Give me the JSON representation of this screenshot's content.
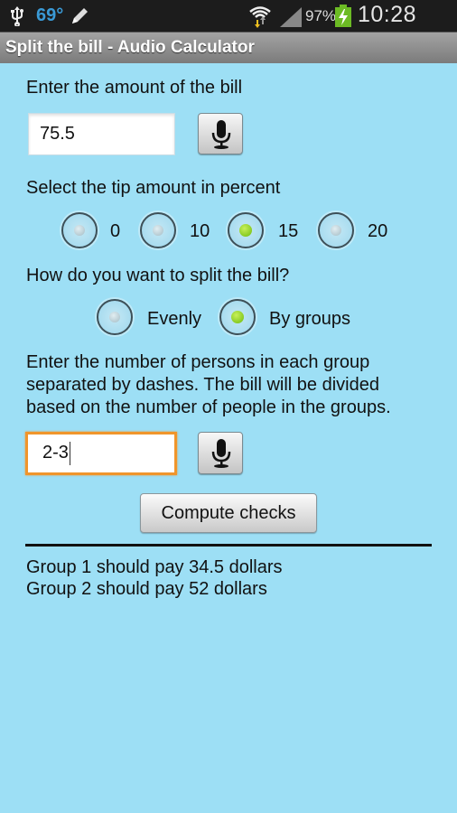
{
  "status_bar": {
    "usb_icon": "usb-icon",
    "temperature": "69°",
    "edit_icon": "pencil-icon",
    "wifi_icon": "wifi-icon",
    "signal_icon": "signal-icon",
    "battery_percent": "97%",
    "battery_icon": "battery-charging-icon",
    "time": "10:28 PM",
    "colors": {
      "temperature": "#3a9ad6",
      "battery": "#6cbb24"
    }
  },
  "title_bar": {
    "title": "Split the bill - Audio Calculator"
  },
  "bill": {
    "label": "Enter the amount of the bill",
    "value": "75.5",
    "mic_icon": "microphone-icon"
  },
  "tip": {
    "label": "Select the tip amount in percent",
    "options": [
      {
        "label": "0",
        "checked": false
      },
      {
        "label": "10",
        "checked": false
      },
      {
        "label": "15",
        "checked": true
      },
      {
        "label": "20",
        "checked": false
      }
    ]
  },
  "split": {
    "label": "How do you want to split the bill?",
    "options": [
      {
        "label": "Evenly",
        "checked": false
      },
      {
        "label": "By groups",
        "checked": true
      }
    ]
  },
  "groups": {
    "instructions": [
      "Enter the number of persons in each group",
      "separated by dashes. The bill will be divided",
      "based on the number of people in the groups."
    ],
    "value": "2-3",
    "mic_icon": "microphone-icon"
  },
  "compute_button": {
    "label": "Compute checks"
  },
  "results": [
    "Group 1 should pay 34.5 dollars",
    "Group 2 should pay 52 dollars"
  ],
  "theme": {
    "background": "#9ddff5",
    "radio_checked": "#8ad62a",
    "focus_border": "#f0952b"
  }
}
